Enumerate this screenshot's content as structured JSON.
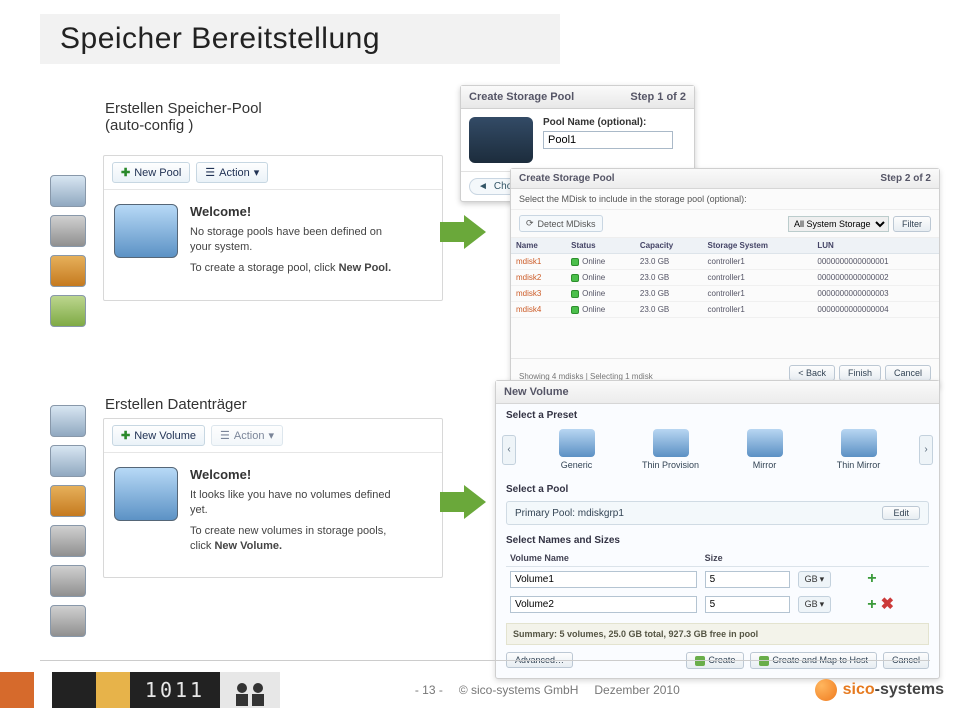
{
  "slide": {
    "title": "Speicher Bereitstellung",
    "page": "- 13 -",
    "copyright": "© sico-systems GmbH",
    "date": "Dezember 2010",
    "brand1": "sico",
    "brand2": "-systems"
  },
  "labels": {
    "pool": "Erstellen Speicher-Pool\n(auto-config )",
    "vol": "Erstellen Datenträger"
  },
  "welcome1": {
    "newBtn": "New Pool",
    "actionBtn": "Action",
    "title": "Welcome!",
    "p1": "No storage pools have been defined on your system.",
    "p2a": "To create a storage pool, click ",
    "p2b": "New Pool."
  },
  "welcome2": {
    "newBtn": "New Volume",
    "actionBtn": "Action",
    "title": "Welcome!",
    "p1": "It looks like you have no volumes defined yet.",
    "p2a": "To create new volumes in storage pools, click ",
    "p2b": "New Volume."
  },
  "modalA": {
    "title": "Create Storage Pool",
    "step": "Step 1 of 2",
    "fieldLabel": "Pool Name (optional):",
    "fieldValue": "Pool1",
    "choose": "Choose Icon"
  },
  "step2": {
    "title": "Create Storage Pool",
    "step": "Step 2 of 2",
    "instr": "Select the MDisk to include in the storage pool (optional):",
    "detect": "Detect MDisks",
    "filterSel": "All System Storage",
    "filter": "Filter",
    "cols": [
      "Name",
      "Status",
      "Capacity",
      "Storage System",
      "LUN"
    ],
    "rows": [
      {
        "name": "mdisk1",
        "status": "Online",
        "cap": "23.0 GB",
        "sys": "controller1",
        "lun": "0000000000000001"
      },
      {
        "name": "mdisk2",
        "status": "Online",
        "cap": "23.0 GB",
        "sys": "controller1",
        "lun": "0000000000000002"
      },
      {
        "name": "mdisk3",
        "status": "Online",
        "cap": "23.0 GB",
        "sys": "controller1",
        "lun": "0000000000000003"
      },
      {
        "name": "mdisk4",
        "status": "Online",
        "cap": "23.0 GB",
        "sys": "controller1",
        "lun": "0000000000000004"
      }
    ],
    "showing": "Showing 4 mdisks | Selecting 1 mdisk",
    "back": "< Back",
    "finish": "Finish",
    "cancel": "Cancel"
  },
  "nv": {
    "title": "New Volume",
    "secPreset": "Select a Preset",
    "presets": [
      "Generic",
      "Thin Provision",
      "Mirror",
      "Thin Mirror"
    ],
    "secPool": "Select a Pool",
    "poolLabel": "Primary Pool: mdiskgrp1",
    "edit": "Edit",
    "secNames": "Select Names and Sizes",
    "cols": [
      "Volume Name",
      "Size"
    ],
    "rows": [
      {
        "name": "Volume1",
        "qty": "5",
        "unit": "GB"
      },
      {
        "name": "Volume2",
        "qty": "5",
        "unit": "GB"
      }
    ],
    "summary": "Summary: 5 volumes, 25.0 GB total, 927.3 GB free in pool",
    "advanced": "Advanced…",
    "create": "Create",
    "createMap": "Create and Map to Host",
    "cancel": "Cancel"
  }
}
